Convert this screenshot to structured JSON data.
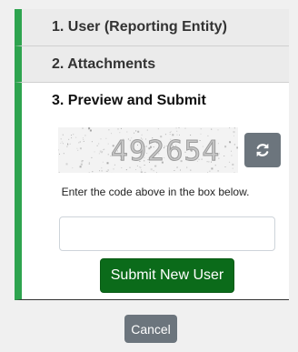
{
  "steps": [
    {
      "label": "1. User (Reporting Entity)"
    },
    {
      "label": "2. Attachments"
    },
    {
      "label": "3. Preview and Submit"
    }
  ],
  "captcha": {
    "code": "492654"
  },
  "refresh": {
    "icon": "refresh-icon"
  },
  "instruction": "Enter the code above in the box below.",
  "code_input": {
    "value": "",
    "placeholder": ""
  },
  "submit_label": "Submit New User",
  "cancel_label": "Cancel",
  "colors": {
    "accent_green": "#2ea44f",
    "submit_green": "#0b6b1a",
    "secondary_gray": "#6c757d"
  }
}
